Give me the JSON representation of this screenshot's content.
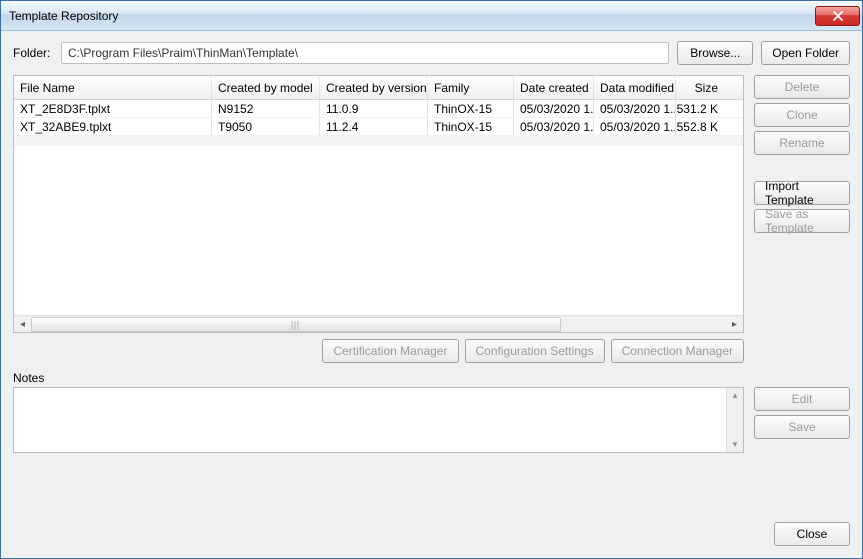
{
  "window": {
    "title": "Template Repository"
  },
  "folder": {
    "label": "Folder:",
    "path": "C:\\Program Files\\Praim\\ThinMan\\Template\\",
    "browse_label": "Browse...",
    "open_label": "Open Folder"
  },
  "table": {
    "columns": {
      "filename": "File Name",
      "model": "Created by model",
      "version": "Created by version",
      "family": "Family",
      "created": "Date created",
      "modified": "Data modified",
      "size": "Size"
    },
    "rows": [
      {
        "filename": "XT_2E8D3F.tplxt",
        "model": "N9152",
        "version": "11.0.9",
        "family": "ThinOX-15",
        "created": "05/03/2020 1...",
        "modified": "05/03/2020 1...",
        "size": "531.2 K"
      },
      {
        "filename": "XT_32ABE9.tplxt",
        "model": "T9050",
        "version": "11.2.4",
        "family": "ThinOX-15",
        "created": "05/03/2020 1...",
        "modified": "05/03/2020 1...",
        "size": "552.8 K"
      }
    ]
  },
  "actions": {
    "delete": "Delete",
    "clone": "Clone",
    "rename": "Rename",
    "import": "Import Template",
    "saveas": "Save as Template",
    "cert": "Certification Manager",
    "config": "Configuration Settings",
    "conn": "Connection Manager",
    "edit": "Edit",
    "save": "Save",
    "close": "Close"
  },
  "notes": {
    "label": "Notes",
    "value": ""
  }
}
